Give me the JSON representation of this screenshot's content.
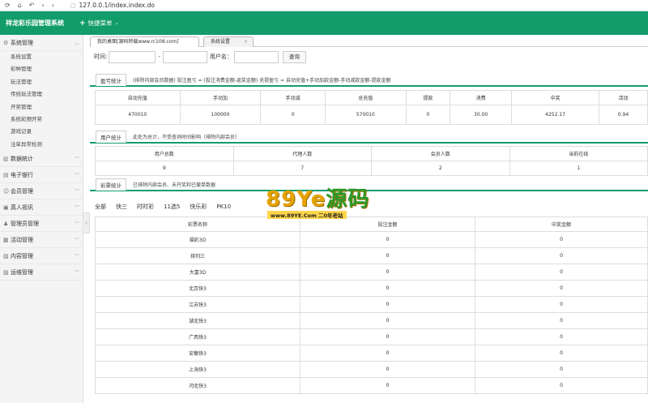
{
  "browser": {
    "url": "127.0.0.1/index.index.do"
  },
  "header": {
    "title": "祥龙彩乐园管理系统",
    "quick_menu": "快捷菜单"
  },
  "sidebar": {
    "groups": [
      {
        "label": "系统管理",
        "icon": "gear-icon",
        "open": true,
        "items": [
          "系统设置",
          "彩种管理",
          "玩法管理",
          "传统玩法管理",
          "开奖管理",
          "系统彩预开奖",
          "游戏记录",
          "注单异常检测"
        ]
      },
      {
        "label": "数据统计",
        "icon": "chart-icon"
      },
      {
        "label": "电子银行",
        "icon": "bank-icon"
      },
      {
        "label": "会员管理",
        "icon": "user-icon"
      },
      {
        "label": "真人视讯",
        "icon": "video-icon"
      },
      {
        "label": "管理员管理",
        "icon": "admin-icon"
      },
      {
        "label": "活动管理",
        "icon": "gift-icon"
      },
      {
        "label": "内容管理",
        "icon": "doc-icon"
      },
      {
        "label": "运维管理",
        "icon": "tool-icon"
      }
    ]
  },
  "tabs": [
    {
      "label": "我的桌面[源码转载www.rc108.com]"
    },
    {
      "label": "系统设置"
    }
  ],
  "search": {
    "time_label": "时间:",
    "dash": "-",
    "user_label": "用户名：",
    "button": "查询"
  },
  "profit": {
    "tag": "盈亏统计",
    "note": "(排除内部会员数据)  投注盈亏 = (投注消费金额-返奖金额)    充提盈亏 = 自动充值+手动加款金额-手动减款金额-提款金额",
    "headers": [
      "自动充值",
      "手动加",
      "手动减",
      "总充值",
      "提款",
      "消费",
      "中奖",
      "活动"
    ],
    "values": [
      "470010",
      "100000",
      "0",
      "570010",
      "0",
      "30.00",
      "4252.17",
      "0.94"
    ]
  },
  "users": {
    "tag": "用户统计",
    "note": "此处为总计，不受查询时间影响（排除内部会员）",
    "headers": [
      "用户总数",
      "代理人数",
      "会员人数",
      "当前在线"
    ],
    "values": [
      "9",
      "7",
      "2",
      "1"
    ]
  },
  "lottery": {
    "tag": "彩票统计",
    "note": "已排除内部会员、未开奖和已撤单数据",
    "tabs": [
      "全部",
      "快三",
      "时时彩",
      "11选5",
      "快乐彩",
      "PK10"
    ],
    "headers": [
      "彩票名称",
      "投注金额",
      "中奖金额"
    ],
    "rows": [
      [
        "福彩3D",
        "0",
        "0"
      ],
      [
        "排列三",
        "0",
        "0"
      ],
      [
        "大富3D",
        "0",
        "0"
      ],
      [
        "北京快3",
        "0",
        "0"
      ],
      [
        "江苏快3",
        "0",
        "0"
      ],
      [
        "湖北快3",
        "0",
        "0"
      ],
      [
        "广西快3",
        "0",
        "0"
      ],
      [
        "安徽快3",
        "0",
        "0"
      ],
      [
        "上海快3",
        "0",
        "0"
      ],
      [
        "河北快3",
        "0",
        "0"
      ]
    ]
  },
  "watermark": {
    "big_a": "89Ye",
    "big_b": "源码",
    "small": "www.89YE.Com  二0年老站"
  }
}
